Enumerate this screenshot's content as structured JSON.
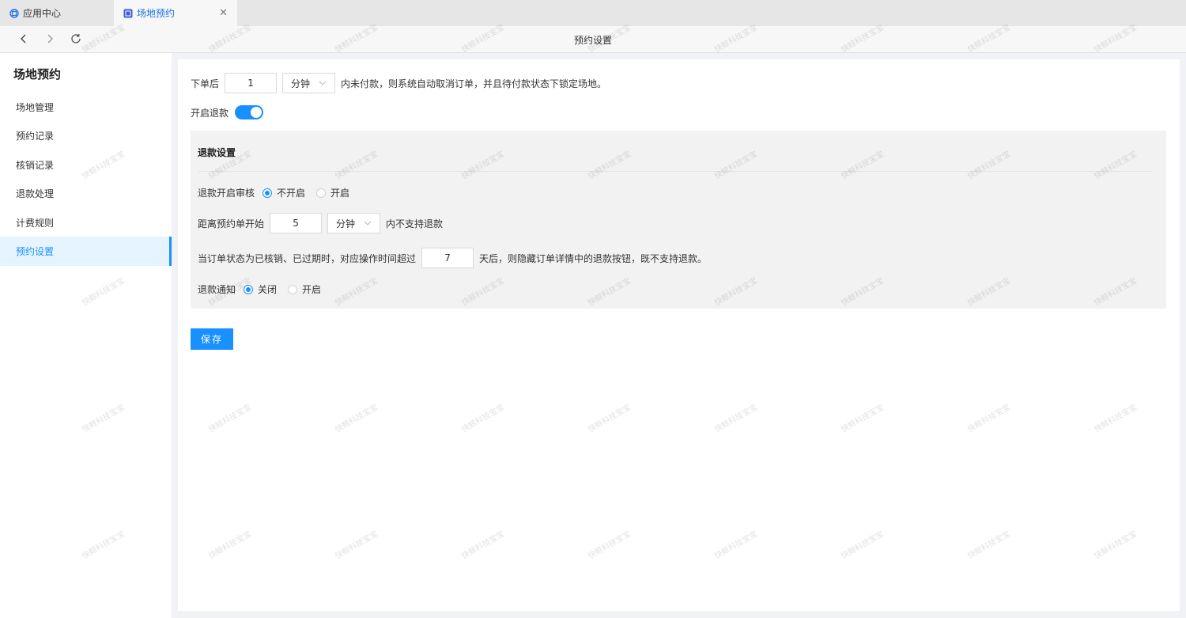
{
  "tabs": [
    {
      "label": "应用中心",
      "icon": "app-center-icon",
      "active": false
    },
    {
      "label": "场地预约",
      "icon": "venue-booking-icon",
      "active": true
    }
  ],
  "nav": {
    "title": "预约设置"
  },
  "sidebar": {
    "title": "场地预约",
    "items": [
      {
        "label": "场地管理"
      },
      {
        "label": "预约记录"
      },
      {
        "label": "核销记录"
      },
      {
        "label": "退款处理"
      },
      {
        "label": "计费规则"
      },
      {
        "label": "预约设置",
        "active": true
      }
    ]
  },
  "order": {
    "prefix": "下单后",
    "value": "1",
    "unit": "分钟",
    "suffix": "内未付款，则系统自动取消订单，并且待付款状态下锁定场地。"
  },
  "refund_toggle": {
    "label": "开启退款",
    "on": true
  },
  "refund": {
    "title": "退款设置",
    "review": {
      "label": "退款开启审核",
      "options": [
        "不开启",
        "开启"
      ],
      "selected": "不开启"
    },
    "before_start": {
      "prefix": "距离预约单开始",
      "value": "5",
      "unit": "分钟",
      "suffix": "内不支持退款"
    },
    "hide_after": {
      "prefix": "当订单状态为已核销、已过期时，对应操作时间超过",
      "value": "7",
      "suffix": "天后，则隐藏订单详情中的退款按钮，既不支持退款。"
    },
    "notify": {
      "label": "退款通知",
      "options": [
        "关闭",
        "开启"
      ],
      "selected": "关闭"
    }
  },
  "save_label": "保存",
  "watermark": "快鲸科技宝宝",
  "colors": {
    "accent": "#1890ff",
    "panel_bg": "#f2f2f2"
  }
}
